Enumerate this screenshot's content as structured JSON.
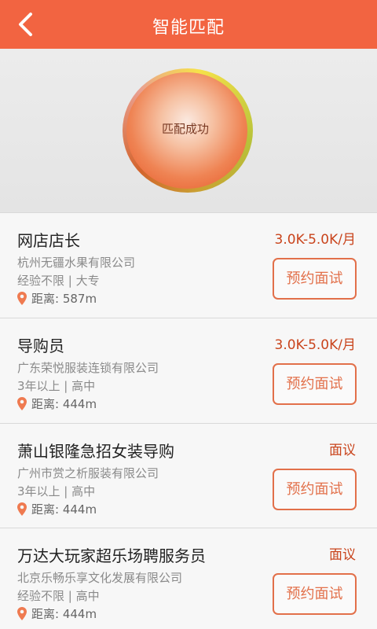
{
  "header": {
    "title": "智能匹配",
    "back_icon": "chevron-left-icon",
    "color": "#f26441"
  },
  "match": {
    "status_text": "匹配成功"
  },
  "jobs": [
    {
      "title": "网店店长",
      "company": "杭州无疆水果有限公司",
      "requirements": "经验不限 | 大专",
      "distance": "距离: 587m",
      "salary": "3.0K-5.0K/月",
      "button_label": "预约面试"
    },
    {
      "title": "导购员",
      "company": "广东荣悦服装连锁有限公司",
      "requirements": "3年以上 | 高中",
      "distance": "距离: 444m",
      "salary": "3.0K-5.0K/月",
      "button_label": "预约面试"
    },
    {
      "title": "萧山银隆急招女装导购",
      "company": "广州市赏之析服装有限公司",
      "requirements": "3年以上 | 高中",
      "distance": "距离: 444m",
      "salary": "面议",
      "button_label": "预约面试"
    },
    {
      "title": "万达大玩家超乐场聘服务员",
      "company": "北京乐畅乐享文化发展有限公司",
      "requirements": "经验不限 | 高中",
      "distance": "距离: 444m",
      "salary": "面议",
      "button_label": "预约面试"
    }
  ],
  "colors": {
    "accent": "#f26441",
    "salary": "#c9441c",
    "button": "#e2704a"
  }
}
